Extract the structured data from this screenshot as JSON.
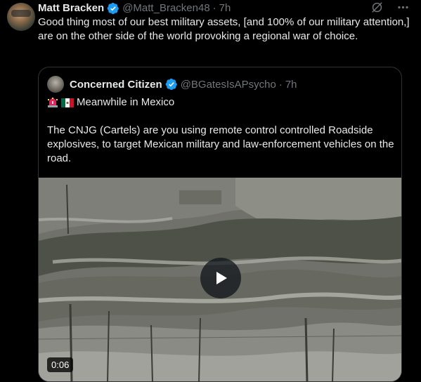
{
  "tweet": {
    "author_name": "Matt Bracken",
    "handle": "@Matt_Bracken48",
    "separator": "·",
    "time": "7h",
    "text": "Good thing most of our best military assets, [and 100% of our military attention,] are on the other side of the world provoking a regional war of choice."
  },
  "quote": {
    "author_name": "Concerned Citizen",
    "handle": "@BGatesIsAPsycho",
    "separator": "·",
    "time": "7h",
    "line1": "Meanwhile in Mexico",
    "body": "The CNJG (Cartels) are you using remote control controlled Roadside explosives, to target Mexican military and law-enforcement vehicles on the road."
  },
  "video": {
    "duration": "0:06"
  },
  "icons": {
    "verified": "verified-badge-icon",
    "grok": "grok-icon",
    "more": "more-icon",
    "play": "play-icon",
    "siren": "siren-emoji",
    "flag": "mexico-flag-emoji"
  },
  "colors": {
    "background": "#000000",
    "text": "#e7e9ea",
    "muted": "#71767b",
    "verified": "#1d9bf0",
    "border": "#2f3336"
  }
}
